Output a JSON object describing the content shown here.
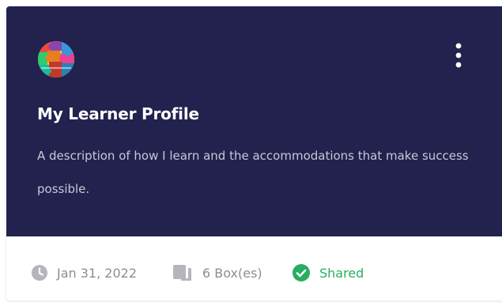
{
  "card": {
    "title": "My Learner Profile",
    "description": "A description of how I learn and the accommodations that make success possible.",
    "avatar_icon": "puzzle-pieces-avatar-icon",
    "menu_icon": "vertical-ellipsis-icon"
  },
  "footer": {
    "date": "Jan 31, 2022",
    "date_icon": "clock-icon",
    "boxes": "6 Box(es)",
    "boxes_icon": "boxes-icon",
    "status": "Shared",
    "status_icon": "check-circle-icon"
  },
  "colors": {
    "card_background": "#23214d",
    "title": "#ffffff",
    "description": "#c9c8d8",
    "meta_text": "#8c8c96",
    "shared_accent": "#27ae60"
  }
}
